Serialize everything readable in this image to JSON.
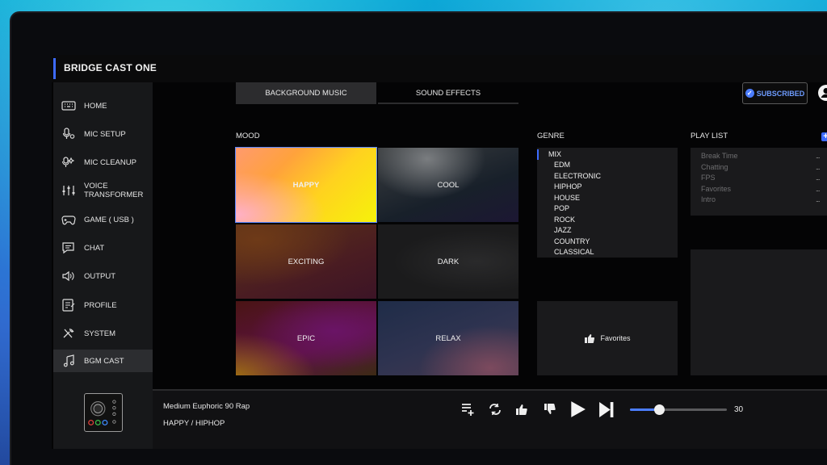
{
  "app": {
    "title": "BRIDGE CAST ONE"
  },
  "sidebar": {
    "items": [
      {
        "label": "HOME",
        "icon": "keyboard-icon"
      },
      {
        "label": "MIC SETUP",
        "icon": "mic-settings-icon"
      },
      {
        "label": "MIC CLEANUP",
        "icon": "mic-sparkle-icon"
      },
      {
        "label": "VOICE TRANSFORMER",
        "icon": "mixer-icon"
      },
      {
        "label": "GAME ( USB )",
        "icon": "gamepad-icon"
      },
      {
        "label": "CHAT",
        "icon": "chat-icon"
      },
      {
        "label": "OUTPUT",
        "icon": "speaker-icon"
      },
      {
        "label": "PROFILE",
        "icon": "profile-icon"
      },
      {
        "label": "SYSTEM",
        "icon": "wrench-icon"
      },
      {
        "label": "BGM CAST",
        "icon": "music-note-icon",
        "active": true
      }
    ]
  },
  "tabs": [
    {
      "label": "BACKGROUND MUSIC",
      "selected": true
    },
    {
      "label": "SOUND EFFECTS",
      "selected": false
    }
  ],
  "header": {
    "subscribed_label": "SUBSCRIBED"
  },
  "mood": {
    "label": "MOOD",
    "tiles": [
      {
        "label": "HAPPY",
        "selected": true
      },
      {
        "label": "COOL"
      },
      {
        "label": "EXCITING"
      },
      {
        "label": "DARK"
      },
      {
        "label": "EPIC"
      },
      {
        "label": "RELAX"
      }
    ]
  },
  "genre": {
    "label": "GENRE",
    "items": [
      "MIX",
      "EDM",
      "ELECTRONIC",
      "HIPHOP",
      "HOUSE",
      "POP",
      "ROCK",
      "JAZZ",
      "COUNTRY",
      "CLASSICAL"
    ],
    "selected": "MIX",
    "favorites_label": "Favorites"
  },
  "playlist": {
    "label": "PLAY LIST",
    "items": [
      "Break Time",
      "Chatting",
      "FPS",
      "Favorites",
      "Intro"
    ],
    "more_label": "..."
  },
  "player": {
    "track": "Medium Euphoric 90 Rap",
    "subtitle": "HAPPY / HIPHOP",
    "volume": 30,
    "volume_fraction": 0.3
  },
  "colors": {
    "accent": "#3d6bff",
    "panel": "#1a1a1c",
    "background": "#040405"
  }
}
